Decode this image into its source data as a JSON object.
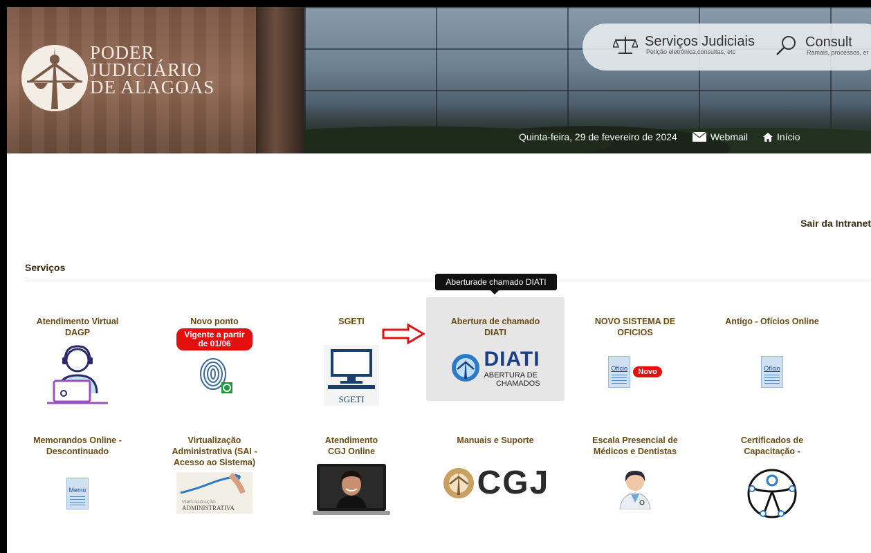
{
  "header": {
    "brand_lines": [
      "PODER",
      "JUDICIÁRIO",
      "DE ALAGOAS"
    ],
    "services_judiciais": {
      "title": "Serviços Judiciais",
      "subtitle": "Petição eletrônica,consultas, etc"
    },
    "consulta": {
      "title": "Consult",
      "subtitle": "Ramais, processos, er"
    },
    "date": "Quinta-feira, 29 de fevereiro de 2024",
    "webmail": "Webmail",
    "inicio": "Início"
  },
  "logout": "Sair da Intranet",
  "section_title": "Serviços",
  "tooltip": "Aberturade chamado DIATI",
  "tiles": [
    {
      "label": "Atendimento Virtual DAGP"
    },
    {
      "label": "Novo ponto",
      "badge": "Vigente a partir de 01/06"
    },
    {
      "label": "SGETI",
      "img_text": "SGETI"
    },
    {
      "label": "Abertura de chamado DIATI",
      "img_title": "DIATI",
      "img_sub1": "ABERTURA DE",
      "img_sub2": "CHAMADOS"
    },
    {
      "label": "NOVO SISTEMA DE OFICIOS",
      "doc_label": "Ofício",
      "badge": "Novo"
    },
    {
      "label": "Antigo - Ofícios Online",
      "doc_label": "Ofício"
    },
    {
      "label": "Memorandos Online - Descontinuado",
      "doc_label": "Memo"
    },
    {
      "label": "Virtualização Administrativa (SAI - Acesso ao Sistema)",
      "img_text1": "VIRTUALIZAÇÃO",
      "img_text2": "ADMINISTRATIVA"
    },
    {
      "label": "Atendimento CGJ Online"
    },
    {
      "label": "Manuais e Suporte",
      "img_text": "CGJ"
    },
    {
      "label": "Escala Presencial de Médicos e Dentistas"
    },
    {
      "label": "Certificados de Capacitação -"
    }
  ],
  "colors": {
    "label_brown": "#6a4a10",
    "badge_red": "#e41010",
    "arrow_red": "#e41010"
  }
}
